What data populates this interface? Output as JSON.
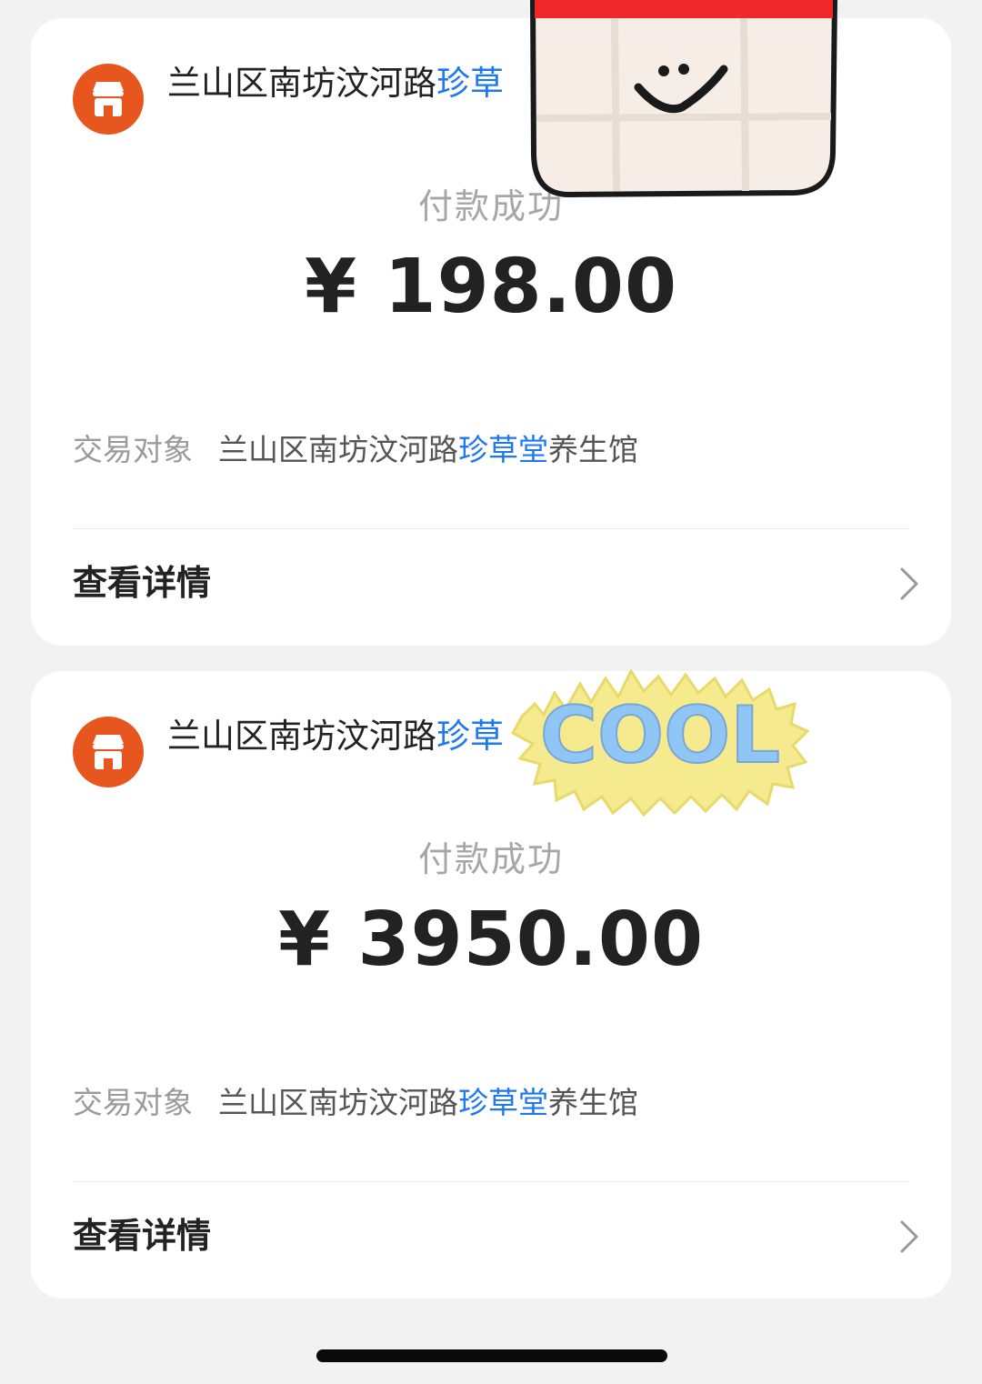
{
  "colors": {
    "brand_orange": "#e8561f",
    "link_blue": "#1e78f0",
    "calendar_red": "#f0282c"
  },
  "cards": [
    {
      "merchant_title_prefix": "兰山区南坊汶河路",
      "merchant_title_highlight": "珍草",
      "status": "付款成功",
      "amount": "¥ 198.00",
      "party_label": "交易对象",
      "party_prefix": "兰山区南坊汶河路",
      "party_highlight": "珍草堂",
      "party_suffix": "养生馆",
      "detail_label": "查看详情"
    },
    {
      "merchant_title_prefix": "兰山区南坊汶河路",
      "merchant_title_highlight": "珍草",
      "status": "付款成功",
      "amount": "¥ 3950.00",
      "party_label": "交易对象",
      "party_prefix": "兰山区南坊汶河路",
      "party_highlight": "珍草堂",
      "party_suffix": "养生馆",
      "detail_label": "查看详情"
    }
  ],
  "stickers": {
    "calendar_icon": "calendar-smile-sticker",
    "cool_text": "COOL"
  },
  "icons": {
    "merchant": "shop-icon",
    "chevron": "chevron-right-icon"
  }
}
